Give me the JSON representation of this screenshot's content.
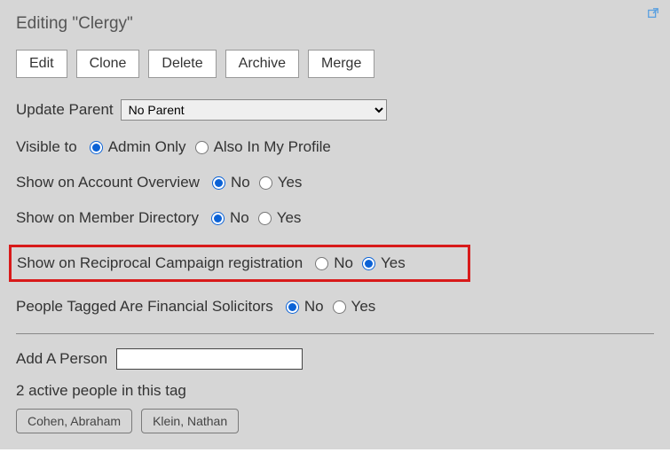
{
  "title": "Editing \"Clergy\"",
  "buttons": {
    "edit": "Edit",
    "clone": "Clone",
    "delete": "Delete",
    "archive": "Archive",
    "merge": "Merge"
  },
  "updateParent": {
    "label": "Update Parent",
    "selected": "No Parent"
  },
  "visibleTo": {
    "label": "Visible to",
    "opt1": "Admin Only",
    "opt2": "Also In My Profile"
  },
  "accountOverview": {
    "label": "Show on Account Overview",
    "no": "No",
    "yes": "Yes"
  },
  "memberDirectory": {
    "label": "Show on Member Directory",
    "no": "No",
    "yes": "Yes"
  },
  "reciprocal": {
    "label": "Show on Reciprocal Campaign registration",
    "no": "No",
    "yes": "Yes"
  },
  "solicitors": {
    "label": "People Tagged Are Financial Solicitors",
    "no": "No",
    "yes": "Yes"
  },
  "addPerson": {
    "label": "Add A Person"
  },
  "countLine": "2 active people in this tag",
  "people": {
    "p0": "Cohen, Abraham",
    "p1": "Klein, Nathan"
  }
}
